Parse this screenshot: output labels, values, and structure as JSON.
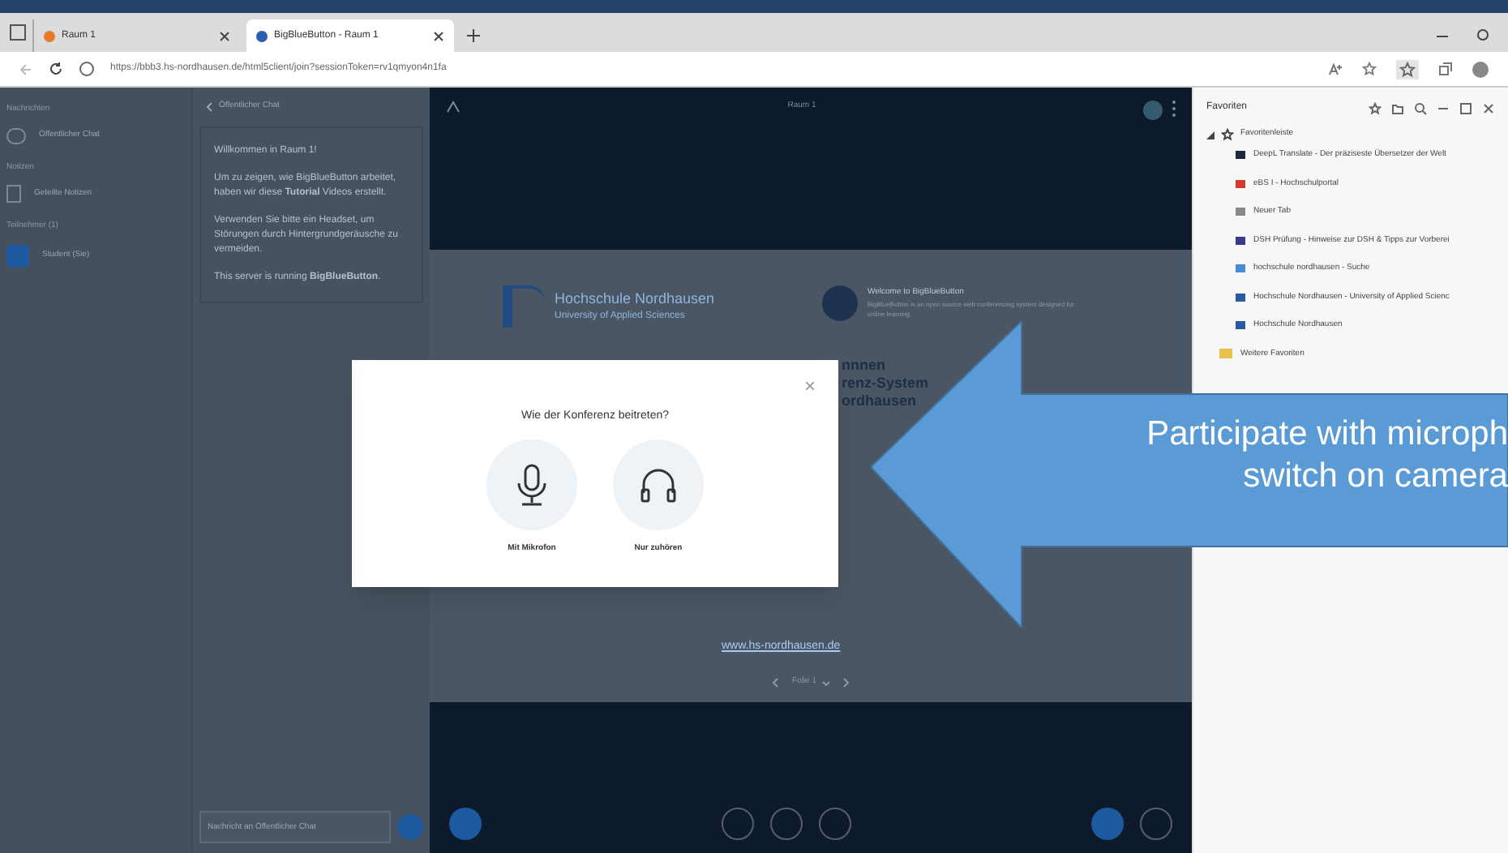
{
  "browser": {
    "tabs": [
      {
        "label": "Raum 1",
        "selected": false
      },
      {
        "label": "BigBlueButton - Raum 1",
        "selected": true
      }
    ],
    "address": "https://bbb3.hs-nordhausen.de/html5client/join?sessionToken=rv1qmyon4n1fa"
  },
  "sidebar": {
    "sections": [
      {
        "title": "Nachrichten",
        "items": [
          {
            "label": "Öffentlicher Chat",
            "kind": "chat"
          }
        ]
      },
      {
        "title": "Notizen",
        "items": [
          {
            "label": "Geteilte Notizen",
            "kind": "notes"
          }
        ]
      },
      {
        "title": "Teilnehmer (1)",
        "items": [
          {
            "label": "Student (Sie)",
            "kind": "user"
          }
        ]
      }
    ]
  },
  "chat": {
    "title": "Öffentlicher Chat",
    "messages": [
      "Willkommen in Raum 1!",
      "Um zu zeigen, wie BigBlueButton arbeitet, haben wir diese **Tutorial** Videos erstellt.",
      "Verwenden Sie bitte ein Headset, um Störungen durch Hintergrundgeräusche zu vermeiden.",
      "This server is running **BigBlueButton**."
    ],
    "placeholder": "Nachricht an Öffentlicher Chat"
  },
  "meeting": {
    "title": "Raum 1",
    "logo_name": "Hochschule Nordhausen",
    "logo_sub": "University of Applied Sciences",
    "welcome_title": "Welcome to BigBlueButton",
    "welcome_text": "BigBlueButton is an open source web conferencing system designed for online learning.",
    "slide_heading": [
      "nnnen",
      "renz-System",
      "ordhausen"
    ],
    "link": "www.hs-nordhausen.de",
    "slide": "Folie 1"
  },
  "modal": {
    "title": "Wie der Konferenz beitreten?",
    "close": "×",
    "options": [
      {
        "label": "Mit Mikrofon",
        "kind": "mic"
      },
      {
        "label": "Nur zuhören",
        "kind": "listen"
      }
    ]
  },
  "favorites": {
    "title": "Favoriten",
    "folder": "Favoritenleiste",
    "expanded": true,
    "items": [
      {
        "label": "DeepL Translate - Der präziseste Übersetzer der Welt",
        "color": "#1e2a3a"
      },
      {
        "label": "eBS I - Hochschulportal",
        "color": "#d43b2f"
      },
      {
        "label": "Neuer Tab",
        "color": "#888888"
      },
      {
        "label": "DSH Prüfung - Hinweise zur DSH & Tipps zur Vorberei",
        "color": "#3a3a8a"
      },
      {
        "label": "hochschule nordhausen - Suche",
        "color": "#4a8ad4"
      },
      {
        "label": "Hochschule Nordhausen - University of Applied Scienc",
        "color": "#2c5aa0"
      },
      {
        "label": "Hochschule Nordhausen",
        "color": "#2c5aa0"
      }
    ],
    "more": "Weitere Favoriten"
  },
  "callout": {
    "lines": [
      "Participate with microph",
      "switch on camera"
    ]
  }
}
